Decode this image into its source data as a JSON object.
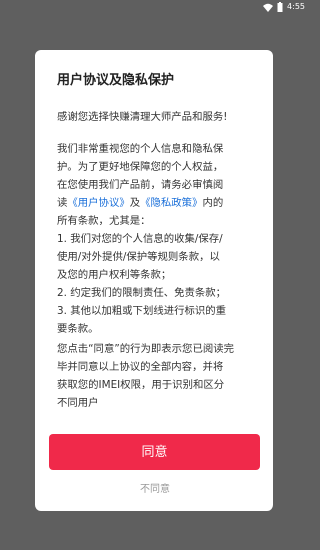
{
  "status_bar": {
    "time": "4:55",
    "icons": [
      "wifi-icon",
      "battery-icon"
    ]
  },
  "dialog": {
    "title": "用户协议及隐私保护",
    "intro": "感谢您选择快赚清理大师产品和服务!",
    "body": {
      "l1": "我们非常重视您的个人信息和隐私保",
      "l2": "护。为了更好地保障您的个人权益，",
      "l3": "在您使用我们产品前，请务必审慎阅",
      "l4_pre": "读",
      "user_agreement_link": "《用户协议》",
      "l4_mid": "及",
      "privacy_policy_link": "《隐私政策》",
      "l4_post": "内的",
      "l5": "所有条款，尤其是：",
      "l6": "1. 我们对您的个人信息的收集/保存/",
      "l7": "使用/对外提供/保护等规则条款，以",
      "l8": "及您的用户权利等条款；",
      "l9": "2. 约定我们的限制责任、免责条款；",
      "l10": "3. 其他以加粗或下划线进行标识的重",
      "l11": "要条款。"
    },
    "consent": {
      "l1": "您点击“同意”的行为即表示您已阅读完",
      "l2": "毕并同意以上协议的全部内容，并将",
      "l3": "获取您的IMEI权限，用于识别和区分",
      "l4": "不同用户"
    },
    "agree_label": "同意",
    "disagree_label": "不同意"
  },
  "colors": {
    "overlay": "#5f5f5f",
    "accent_button": "#f0294a",
    "link": "#1a6fd9"
  }
}
